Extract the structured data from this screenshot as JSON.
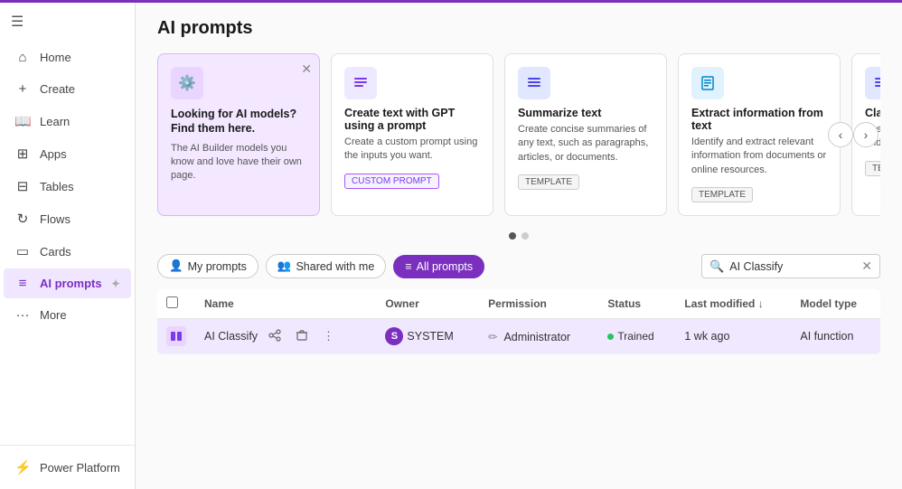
{
  "topbar": {
    "accent_color": "#7b2fbe"
  },
  "sidebar": {
    "hamburger_icon": "☰",
    "items": [
      {
        "id": "home",
        "label": "Home",
        "icon": "⌂"
      },
      {
        "id": "create",
        "label": "Create",
        "icon": "+"
      },
      {
        "id": "learn",
        "label": "Learn",
        "icon": "📖"
      },
      {
        "id": "apps",
        "label": "Apps",
        "icon": "⊞"
      },
      {
        "id": "tables",
        "label": "Tables",
        "icon": "⊟"
      },
      {
        "id": "flows",
        "label": "Flows",
        "icon": "↻"
      },
      {
        "id": "cards",
        "label": "Cards",
        "icon": "▭"
      },
      {
        "id": "ai-prompts",
        "label": "AI prompts",
        "icon": "≡",
        "active": true
      },
      {
        "id": "more",
        "label": "More",
        "icon": "···"
      }
    ],
    "bottom_items": [
      {
        "id": "power-platform",
        "label": "Power Platform",
        "icon": "⚡"
      }
    ]
  },
  "page": {
    "title": "AI prompts"
  },
  "carousel": {
    "prev_label": "‹",
    "next_label": "›",
    "cards": [
      {
        "id": "promo",
        "type": "promo",
        "icon": "⚙",
        "title": "Looking for AI models? Find them here.",
        "desc": "The AI Builder models you know and love have their own page."
      },
      {
        "id": "create-text-gpt",
        "type": "template",
        "icon": "≡",
        "title": "Create text with GPT using a prompt",
        "desc": "Create a custom prompt using the inputs you want.",
        "badge": "CUSTOM PROMPT",
        "badge_type": "custom"
      },
      {
        "id": "summarize-text",
        "type": "template",
        "icon": "≡",
        "title": "Summarize text",
        "desc": "Create concise summaries of any text, such as paragraphs, articles, or documents.",
        "badge": "TEMPLATE",
        "badge_type": "default"
      },
      {
        "id": "extract-information",
        "type": "template",
        "icon": "⊡",
        "title": "Extract information from text",
        "desc": "Identify and extract relevant information from documents or online resources.",
        "badge": "TEMPLATE",
        "badge_type": "default"
      },
      {
        "id": "classify-text",
        "type": "template",
        "icon": "≡",
        "title": "Classify text",
        "desc": "Assign a set of p... to open-ended t...",
        "badge": "TEMPLATE",
        "badge_type": "default"
      }
    ],
    "dots": [
      {
        "active": true
      },
      {
        "active": false
      }
    ]
  },
  "filters": {
    "my_prompts_label": "My prompts",
    "shared_with_me_label": "Shared with me",
    "all_prompts_label": "All prompts"
  },
  "search": {
    "value": "AI Classify",
    "placeholder": "Search"
  },
  "table": {
    "columns": [
      {
        "id": "checkbox",
        "label": ""
      },
      {
        "id": "name",
        "label": "Name"
      },
      {
        "id": "owner",
        "label": "Owner"
      },
      {
        "id": "permission",
        "label": "Permission"
      },
      {
        "id": "status",
        "label": "Status"
      },
      {
        "id": "last_modified",
        "label": "Last modified ↓"
      },
      {
        "id": "model_type",
        "label": "Model type"
      }
    ],
    "rows": [
      {
        "id": "ai-classify",
        "name": "AI Classify",
        "owner_avatar": "S",
        "owner_name": "SYSTEM",
        "permission_icon": "✏",
        "permission": "Administrator",
        "status": "Trained",
        "status_color": "#22c55e",
        "last_modified": "1 wk ago",
        "model_type": "AI function",
        "selected": true
      }
    ]
  }
}
